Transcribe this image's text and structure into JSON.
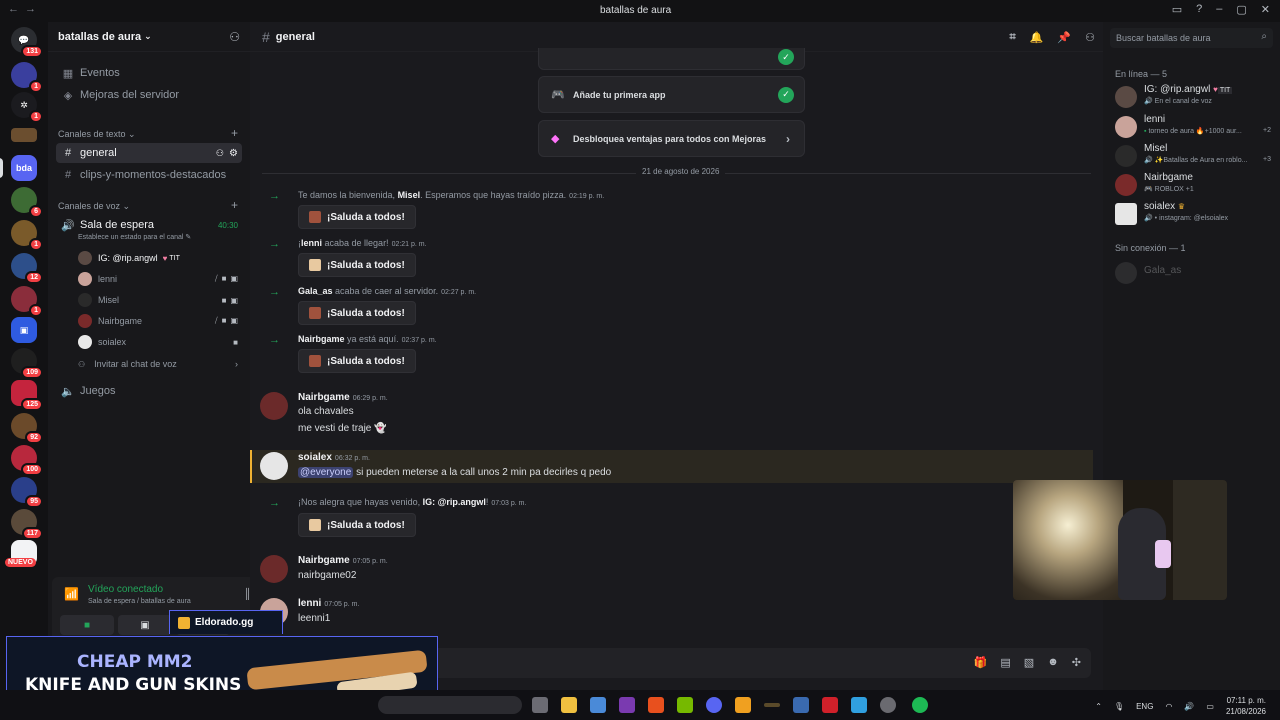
{
  "titlebar": {
    "title": "batallas de aura"
  },
  "guilds": {
    "badges": [
      "131",
      "1",
      "1",
      "",
      "",
      "6",
      "1",
      "12",
      "1",
      "",
      "109",
      "125",
      "92",
      "100",
      "95",
      "117"
    ],
    "nuevo": "NUEVO"
  },
  "server": {
    "name": "batallas de aura",
    "events": "Eventos",
    "boosts": "Mejoras del servidor",
    "text_category": "Canales de texto",
    "text_channels": [
      "general",
      "clips-y-momentos-destacados"
    ],
    "voice_category": "Canales de voz",
    "voice_channel": "Sala de espera",
    "voice_time": "40:30",
    "voice_status_prompt": "Establece un estado para el canal",
    "voice_users": [
      "IG: @rip.angwl",
      "lenni",
      "Misel",
      "Nairbgame",
      "soialex"
    ],
    "voice_user0_tag": "TIT",
    "invite": "Invitar al chat de voz",
    "games_channel": "Juegos"
  },
  "voice_panel": {
    "status": "Vídeo conectado",
    "location": "Sala de espera / batallas de aura"
  },
  "ad": {
    "tab_label": "Eldorado.gg",
    "line1": "CHEAP MM2",
    "line2": "KNIFE AND GUN SKINS"
  },
  "channel": {
    "name": "general",
    "cards": [
      {
        "label": "Añade tu primera app"
      },
      {
        "label": "Desbloquea ventajas para todos con Mejoras"
      }
    ],
    "date_divider": "21 de agosto de 2026",
    "wave_label": "¡Saluda a todos!",
    "sys1": {
      "pre": "Te damos la bienvenida, ",
      "name": "Misel",
      "post": ". Esperamos que hayas traído pizza.",
      "time": "02:19 p. m."
    },
    "sys2": {
      "pre": "¡",
      "name": "lenni",
      "post": " acaba de llegar!",
      "time": "02:21 p. m."
    },
    "sys3": {
      "pre": "",
      "name": "Gala_as",
      "post": " acaba de caer al servidor.",
      "time": "02:27 p. m."
    },
    "sys4": {
      "pre": "",
      "name": "Nairbgame",
      "post": " ya está aquí.",
      "time": "02:37 p. m."
    },
    "sys5": {
      "pre": "¡Nos alegra que hayas venido, ",
      "name": "IG: @rip.angwl",
      "post": "!",
      "time": "07:03 p. m."
    },
    "msg1": {
      "author": "Nairbgame",
      "time": "06:29 p. m.",
      "line1": "ola chavales",
      "line2": "me vesti de traje"
    },
    "msg2": {
      "author": "soialex",
      "time": "06:32 p. m.",
      "mention": "@everyone",
      "text": " si pueden meterse a la call unos 2 min pa decirles q pedo"
    },
    "msg3": {
      "author": "Nairbgame",
      "time": "07:05 p. m.",
      "text": "nairbgame02"
    },
    "msg4": {
      "author": "lenni",
      "time": "07:05 p. m.",
      "text": "leenni1"
    }
  },
  "search": {
    "placeholder": "Buscar batallas de aura"
  },
  "members": {
    "online_header": "En línea — 5",
    "offline_header": "Sin conexión — 1",
    "list": [
      {
        "name": "IG: @rip.angwl",
        "tag": "TIT",
        "status": "En el canal de voz",
        "count": ""
      },
      {
        "name": "lenni",
        "status": "torneo de aura 🔥+1000 aur...",
        "count": "+2"
      },
      {
        "name": "Misel",
        "status": "✨Batallas de Aura en roblo...",
        "count": "+3"
      },
      {
        "name": "Nairbgame",
        "status": "ROBLOX +1",
        "count": ""
      },
      {
        "name": "soialex",
        "status": "• instagram: @elsoialex",
        "count": ""
      }
    ],
    "offline": [
      {
        "name": "Gala_as"
      }
    ]
  },
  "taskbar": {
    "lang": "ENG",
    "time": "07:11 p. m.",
    "date": "21/08/2026"
  },
  "colors": {
    "accent": "#5865f2",
    "online": "#23a55a",
    "mention_bar": "#f0b232",
    "badge": "#f23f43"
  }
}
